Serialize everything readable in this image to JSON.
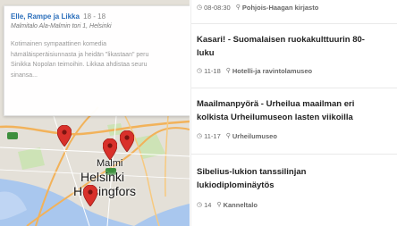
{
  "popup": {
    "title": "Elle, Rampe ja Likka",
    "date": "18 - 18",
    "address": "Malmitalo Ala-Malmin tori 1, Helsinki",
    "description_lines": [
      "Kotimainen sympaattinen komedia",
      "hämäläisperäisiunnasta ja heidän \"likastaan\" peru",
      "Sinikka Nopolan teimoihin. Likkaa ahdistaa seuru",
      "sinansa..."
    ]
  },
  "map": {
    "labels": [
      "Helsinki",
      "Helsingfors",
      "Malmi"
    ],
    "pin_color": "#d9312b"
  },
  "events": [
    {
      "time_icon": "clock-icon",
      "time": "08-08:30",
      "place_icon": "map-marker-icon",
      "place": "Pohjois-Haagan kirjasto",
      "title_lines": []
    },
    {
      "time": "11-18",
      "place": "Hotelli-ja ravintolamuseo",
      "title_lines": [
        "Kasari! - Suomalaisen ruokakulttuurin 80-",
        "luku"
      ]
    },
    {
      "time": "11-17",
      "place": "Urheilumuseo",
      "title_lines": [
        "Maailmanpyörä - Urheilua maailman eri",
        "kolkista Urheilumuseon lasten viikoilla"
      ]
    },
    {
      "time": "14",
      "place": "Kanneltalo",
      "title_lines": [
        "Sibelius-lukion tanssilinjan",
        "lukiodiplominäytös"
      ]
    }
  ]
}
